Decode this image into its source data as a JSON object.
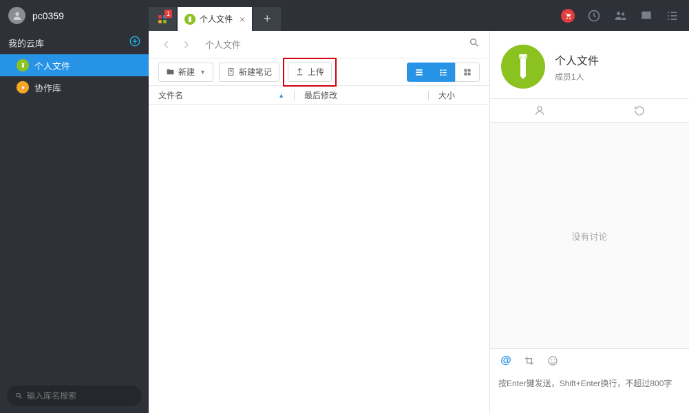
{
  "sidebar": {
    "user_name": "pc0359",
    "header_label": "我的云库",
    "nav": [
      {
        "label": "个人文件",
        "active": true
      },
      {
        "label": "协作库",
        "active": false
      }
    ],
    "search_placeholder": "输入库名搜索"
  },
  "tabs": {
    "badge_count": "1",
    "active_label": "个人文件"
  },
  "breadcrumb": {
    "path": "个人文件"
  },
  "toolbar": {
    "new_label": "新建",
    "note_label": "新建笔记",
    "upload_label": "上传"
  },
  "columns": {
    "name": "文件名",
    "modified": "最后修改",
    "size": "大小"
  },
  "right_panel": {
    "title": "个人文件",
    "subtitle": "成员1人",
    "empty_text": "没有讨论",
    "comment_placeholder": "按Enter键发送，Shift+Enter换行，不超过800字"
  }
}
